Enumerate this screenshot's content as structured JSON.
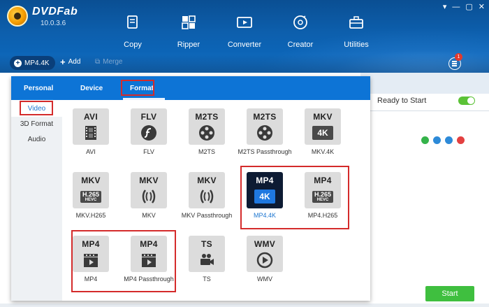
{
  "app": {
    "brand": "DVDFab",
    "version": "10.0.3.6"
  },
  "window_controls": [
    "▾",
    "—",
    "▢",
    "✕"
  ],
  "nav": [
    {
      "label": "Copy",
      "icon": "copy-icon"
    },
    {
      "label": "Ripper",
      "icon": "ripper-icon"
    },
    {
      "label": "Converter",
      "icon": "converter-icon"
    },
    {
      "label": "Creator",
      "icon": "creator-icon"
    },
    {
      "label": "Utilities",
      "icon": "utilities-icon"
    }
  ],
  "toolbar": {
    "profile": "MP4.4K",
    "add": "Add",
    "merge": "Merge",
    "task_count": "1"
  },
  "popup": {
    "tabs": {
      "personal": "Personal",
      "device": "Device",
      "format": "Format"
    },
    "sidebar": {
      "video": "Video",
      "format3d": "3D Format",
      "audio": "Audio"
    }
  },
  "tiles": [
    {
      "fmt": "AVI",
      "label": "AVI",
      "sym": "film"
    },
    {
      "fmt": "FLV",
      "label": "FLV",
      "sym": "flash"
    },
    {
      "fmt": "M2TS",
      "label": "M2TS",
      "sym": "reel"
    },
    {
      "fmt": "M2TS",
      "label": "M2TS Passthrough",
      "sym": "reel"
    },
    {
      "fmt": "MKV",
      "label": "MKV.4K",
      "sym": "4k"
    },
    {
      "fmt": "MKV",
      "label": "MKV.H265",
      "sym": "h265"
    },
    {
      "fmt": "MKV",
      "label": "MKV",
      "sym": "matroska"
    },
    {
      "fmt": "MKV",
      "label": "MKV Passthrough",
      "sym": "matroska"
    },
    {
      "fmt": "MP4",
      "label": "MP4.4K",
      "sym": "4k",
      "active": true
    },
    {
      "fmt": "MP4",
      "label": "MP4.H265",
      "sym": "h265"
    },
    {
      "fmt": "MP4",
      "label": "MP4",
      "sym": "clapper"
    },
    {
      "fmt": "MP4",
      "label": "MP4 Passthrough",
      "sym": "clapper"
    },
    {
      "fmt": "TS",
      "label": "TS",
      "sym": "camera"
    },
    {
      "fmt": "WMV",
      "label": "WMV",
      "sym": "play"
    }
  ],
  "badges": {
    "h265_main": "H.265",
    "h265_sub": "HEVC",
    "k4": "4K"
  },
  "right_panel": {
    "ready_label": "Ready to Start",
    "start": "Start"
  },
  "colors": {
    "accent": "#0d74d6",
    "highlight": "#d42b2b",
    "start_green": "#3fbf3f"
  }
}
